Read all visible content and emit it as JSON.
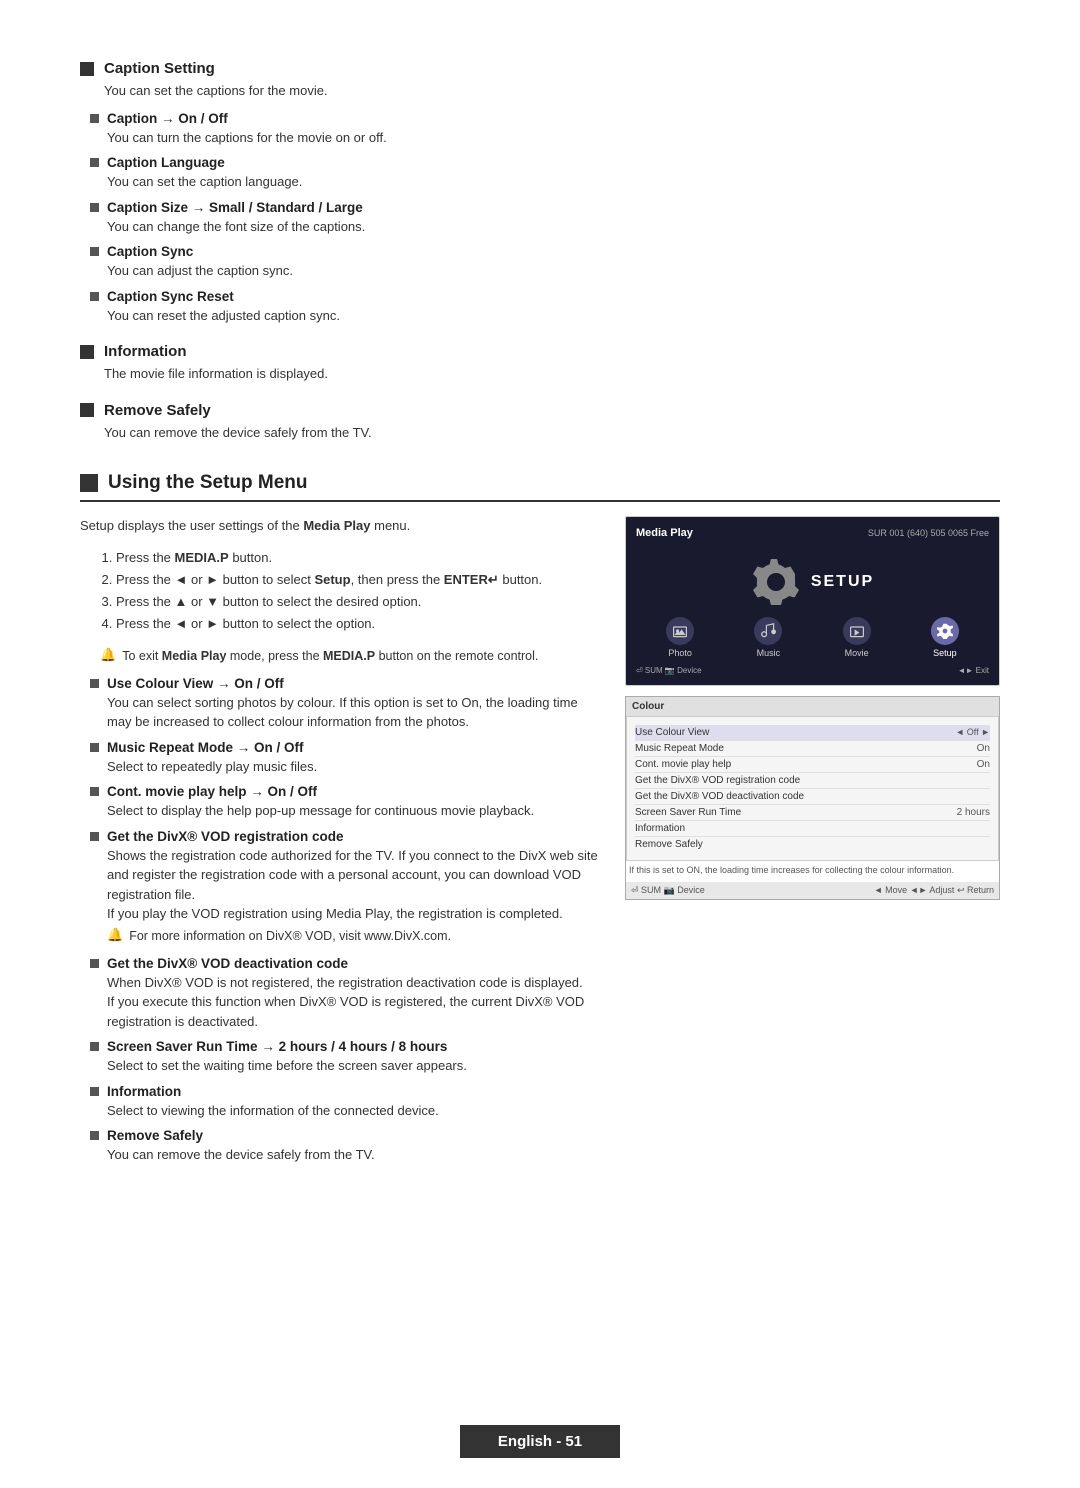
{
  "caption_setting": {
    "title": "Caption Setting",
    "desc": "You can set the captions for the movie.",
    "sub_items": [
      {
        "title": "Caption → On / Off",
        "desc": "You can turn the captions for the movie on or off."
      },
      {
        "title": "Caption Language",
        "desc": "You can set the caption language."
      },
      {
        "title": "Caption Size → Small / Standard / Large",
        "desc": "You can change the font size of the captions."
      },
      {
        "title": "Caption Sync",
        "desc": "You can adjust the caption sync."
      },
      {
        "title": "Caption Sync Reset",
        "desc": "You can reset the adjusted caption sync."
      }
    ]
  },
  "information": {
    "title": "Information",
    "desc": "The movie file information is displayed."
  },
  "remove_safely": {
    "title": "Remove Safely",
    "desc": "You can remove the device safely from the TV."
  },
  "using_setup": {
    "title": "Using the Setup Menu",
    "intro": "Setup displays the user settings of the Media Play menu.",
    "steps": [
      "Press the MEDIA.P button.",
      "Press the ◄ or ► button to select Setup, then press the ENTER↵ button.",
      "Press the ▲ or ▼ button to select the desired option.",
      "Press the ◄ or ► button to select the option."
    ],
    "note": "To exit Media Play mode, press the MEDIA.P button on the remote control.",
    "sub_items": [
      {
        "title": "Use Colour View → On / Off",
        "desc": "You can select sorting photos by colour. If this option is set to On, the loading time may be increased to collect colour information from the photos."
      },
      {
        "title": "Music Repeat Mode → On / Off",
        "desc": "Select to repeatedly play music files."
      },
      {
        "title": "Cont. movie play help → On / Off",
        "desc": "Select to display the help pop-up message for continuous movie playback."
      },
      {
        "title": "Get the DivX® VOD registration code",
        "desc": "Shows the registration code authorized for the TV. If you connect to the DivX web site and register the registration code with a personal account, you can download VOD registration file.\nIf you play the VOD registration using Media Play, the registration is completed.",
        "note": "For more information on DivX® VOD, visit www.DivX.com."
      },
      {
        "title": "Get the DivX® VOD deactivation code",
        "desc": "When DivX® VOD is not registered, the registration deactivation code is displayed.\nIf you execute this function when DivX® VOD is registered, the current DivX® VOD registration is deactivated."
      },
      {
        "title": "Screen Saver Run Time → 2 hours / 4 hours / 8 hours",
        "desc": "Select to set the waiting time before the screen saver appears."
      },
      {
        "title": "Information",
        "desc": "Select to viewing the information of the connected device."
      },
      {
        "title": "Remove Safely",
        "desc": "You can remove the device safely from the TV."
      }
    ]
  },
  "media_play_screen": {
    "title": "Media Play",
    "sub_info": "SUR 001 (640) 505 0065 Free",
    "setup_label": "SETUP",
    "icons": [
      "Photo",
      "Music",
      "Movie",
      "Setup"
    ],
    "bottom_left": "⏎ SUM  📷 Device",
    "bottom_right": "◄► Exit"
  },
  "setup_options": {
    "title": "Colour",
    "rows": [
      {
        "label": "Use Colour View",
        "val": "Off",
        "arrow": true
      },
      {
        "label": "Music Repeat Mode",
        "val": "On"
      },
      {
        "label": "Cont. movie play help",
        "val": "On"
      },
      {
        "label": "Get the DivX® VOD registration code",
        "val": ""
      },
      {
        "label": "Get the DivX® VOD deactivation code",
        "val": ""
      },
      {
        "label": "Screen Saver Run Time",
        "val": "2 hours"
      },
      {
        "label": "Information",
        "val": ""
      },
      {
        "label": "Remove Safely",
        "val": ""
      }
    ],
    "note": "If this is set to ON, the loading time increases for collecting the colour information.",
    "bottom_left": "⏎ SUM  📷 Device",
    "bottom_right": "◄ Move  ◄► Adjust  ↩ Return"
  },
  "page_number": "English - 51"
}
